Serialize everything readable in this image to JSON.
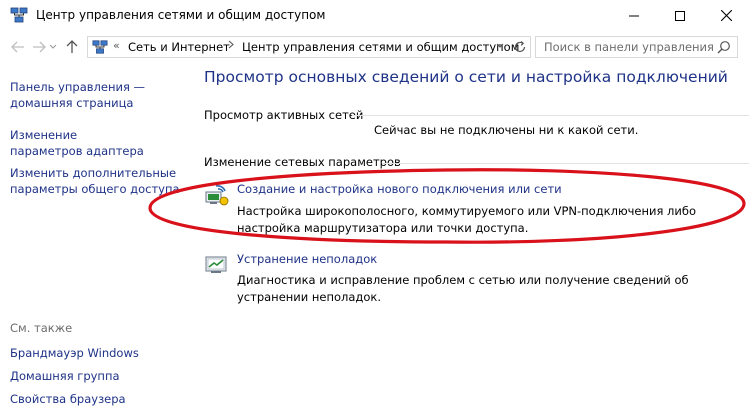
{
  "window": {
    "title": "Центр управления сетями и общим доступом"
  },
  "address": {
    "overflow": "«",
    "crumbs": [
      "Сеть и Интернет",
      "Центр управления сетями и общим доступом"
    ]
  },
  "search": {
    "placeholder": "Поиск в панели управления"
  },
  "sidebar": {
    "home": "Панель управления — домашняя страница",
    "adapter": "Изменение параметров адаптера",
    "sharing": "Изменить дополнительные параметры общего доступа",
    "see_also_heading": "См. также",
    "see_also": [
      "Брандмауэр Windows",
      "Домашняя группа",
      "Свойства браузера"
    ]
  },
  "main": {
    "title": "Просмотр основных сведений о сети и настройка подключений",
    "active_networks_heading": "Просмотр активных сетей",
    "not_connected": "Сейчас вы не подключены ни к какой сети.",
    "change_settings_heading": "Изменение сетевых параметров",
    "tasks": [
      {
        "label": "Создание и настройка нового подключения или сети",
        "description": "Настройка широкополосного, коммутируемого или VPN-подключения либо настройка маршрутизатора или точки доступа."
      },
      {
        "label": "Устранение неполадок",
        "description": "Диагностика и исправление проблем с сетью или получение сведений об устранении неполадок."
      }
    ]
  },
  "annotation": {
    "ellipse_color": "#d9111b"
  }
}
